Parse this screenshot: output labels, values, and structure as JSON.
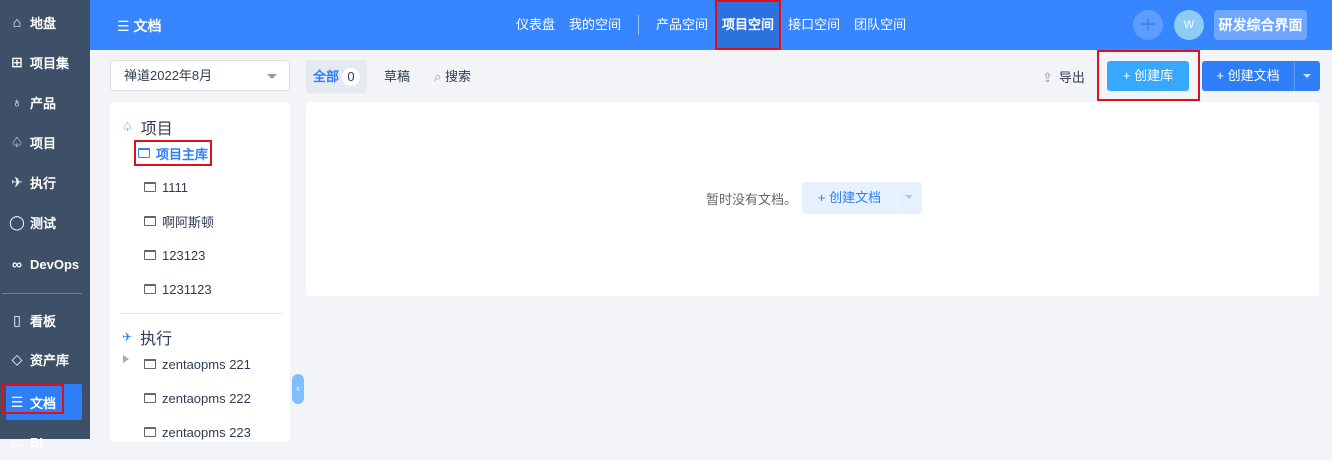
{
  "sidebar": {
    "items": [
      {
        "label": "地盘",
        "icon": "home-icon"
      },
      {
        "label": "项目集",
        "icon": "grid-icon"
      },
      {
        "label": "产品",
        "icon": "bulb-icon"
      },
      {
        "label": "项目",
        "icon": "rocket-icon"
      },
      {
        "label": "执行",
        "icon": "run-icon"
      },
      {
        "label": "测试",
        "icon": "search-icon"
      },
      {
        "label": "DevOps",
        "icon": "infinity-icon"
      },
      {
        "label": "看板",
        "icon": "board-icon"
      },
      {
        "label": "资产库",
        "icon": "diamond-icon"
      },
      {
        "label": "文档",
        "icon": "doc-icon"
      },
      {
        "label": "BI",
        "icon": "chart-icon"
      }
    ],
    "active": "文档"
  },
  "header": {
    "title": "文档",
    "nav": [
      "仪表盘",
      "我的空间",
      "产品空间",
      "项目空间",
      "接口空间",
      "团队空间"
    ],
    "active": "项目空间",
    "avatar": "W",
    "vision": "研发综合界面"
  },
  "library_select": "禅道2022年8月",
  "tree": {
    "project_group": "项目",
    "project_libs": [
      "项目主库",
      "1111",
      "啊阿斯顿",
      "123123",
      "1231123"
    ],
    "execution_group": "执行",
    "execution_libs": [
      "zentaopms 221",
      "zentaopms 222",
      "zentaopms 223"
    ]
  },
  "tabs": {
    "all": "全部",
    "all_count": "0",
    "draft": "草稿",
    "search": "搜索"
  },
  "toolbar": {
    "export": "导出",
    "create_lib": "+ 创建库",
    "create_doc": "+ 创建文档"
  },
  "empty": {
    "message": "暂时没有文档。",
    "create_doc": "+ 创建文档"
  }
}
